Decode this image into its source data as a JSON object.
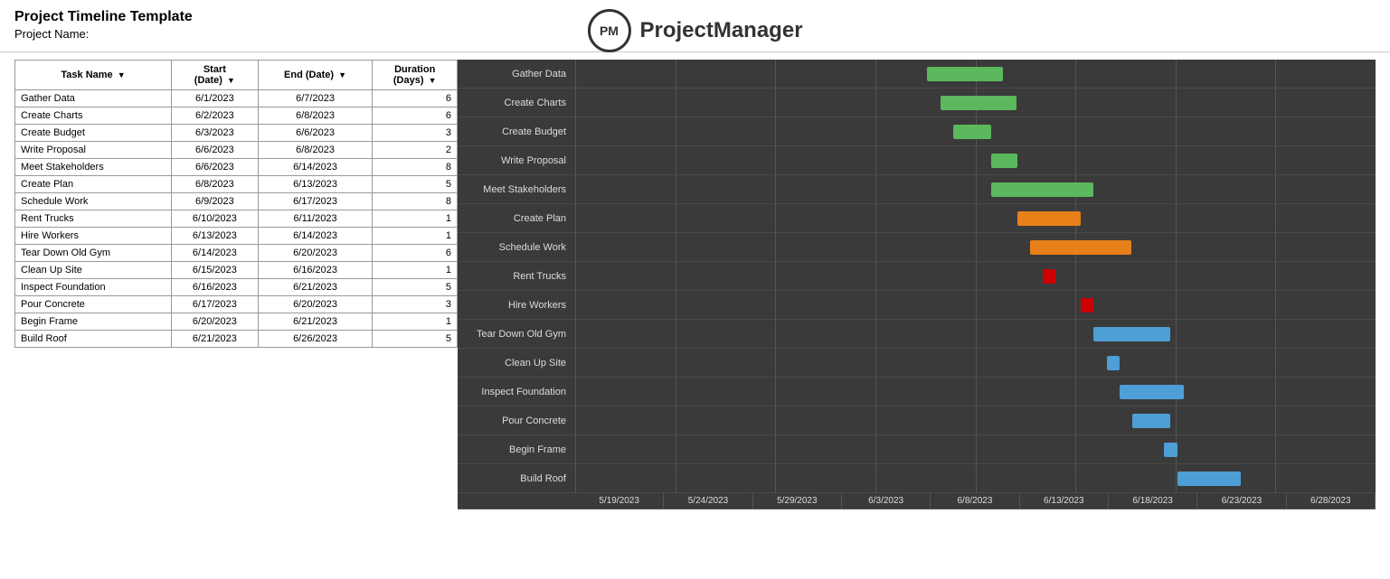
{
  "title": "Project Timeline Template",
  "projectNameLabel": "Project Name:",
  "logo": {
    "initials": "PM",
    "name": "ProjectManager"
  },
  "table": {
    "headers": [
      "Task Name",
      "Start\n(Date)",
      "End  (Date)",
      "Duration\n(Days)"
    ],
    "rows": [
      {
        "name": "Gather Data",
        "start": "6/1/2023",
        "end": "6/7/2023",
        "duration": 6
      },
      {
        "name": "Create Charts",
        "start": "6/2/2023",
        "end": "6/8/2023",
        "duration": 6
      },
      {
        "name": "Create Budget",
        "start": "6/3/2023",
        "end": "6/6/2023",
        "duration": 3
      },
      {
        "name": "Write Proposal",
        "start": "6/6/2023",
        "end": "6/8/2023",
        "duration": 2
      },
      {
        "name": "Meet Stakeholders",
        "start": "6/6/2023",
        "end": "6/14/2023",
        "duration": 8
      },
      {
        "name": "Create Plan",
        "start": "6/8/2023",
        "end": "6/13/2023",
        "duration": 5
      },
      {
        "name": "Schedule Work",
        "start": "6/9/2023",
        "end": "6/17/2023",
        "duration": 8
      },
      {
        "name": "Rent Trucks",
        "start": "6/10/2023",
        "end": "6/11/2023",
        "duration": 1
      },
      {
        "name": "Hire Workers",
        "start": "6/13/2023",
        "end": "6/14/2023",
        "duration": 1
      },
      {
        "name": "Tear Down Old Gym",
        "start": "6/14/2023",
        "end": "6/20/2023",
        "duration": 6
      },
      {
        "name": "Clean Up Site",
        "start": "6/15/2023",
        "end": "6/16/2023",
        "duration": 1
      },
      {
        "name": "Inspect Foundation",
        "start": "6/16/2023",
        "end": "6/21/2023",
        "duration": 5
      },
      {
        "name": "Pour Concrete",
        "start": "6/17/2023",
        "end": "6/20/2023",
        "duration": 3
      },
      {
        "name": "Begin Frame",
        "start": "6/20/2023",
        "end": "6/21/2023",
        "duration": 1
      },
      {
        "name": "Build Roof",
        "start": "6/21/2023",
        "end": "6/26/2023",
        "duration": 5
      }
    ]
  },
  "gantt": {
    "dateLabels": [
      "5/19/2023",
      "5/24/2023",
      "5/29/2023",
      "6/3/2023",
      "6/8/2023",
      "6/13/2023",
      "6/18/2023",
      "6/23/2023",
      "6/28/2023"
    ],
    "rowLabels": [
      "Gather Data",
      "Create Charts",
      "Create Budget",
      "Write Proposal",
      "Meet Stakeholders",
      "Create Plan",
      "Schedule Work",
      "Rent Trucks",
      "Hire Workers",
      "Tear Down Old Gym",
      "Clean Up Site",
      "Inspect Foundation",
      "Pour Concrete",
      "Begin Frame",
      "Build Roof"
    ],
    "bars": [
      {
        "color": "#5cb85c",
        "startPct": 44.0,
        "widthPct": 9.5
      },
      {
        "color": "#5cb85c",
        "startPct": 45.6,
        "widthPct": 9.5
      },
      {
        "color": "#5cb85c",
        "startPct": 47.2,
        "widthPct": 4.8
      },
      {
        "color": "#5cb85c",
        "startPct": 52.0,
        "widthPct": 3.2
      },
      {
        "color": "#5cb85c",
        "startPct": 52.0,
        "widthPct": 12.7
      },
      {
        "color": "#e8801a",
        "startPct": 55.2,
        "widthPct": 8.0
      },
      {
        "color": "#e8801a",
        "startPct": 56.8,
        "widthPct": 12.7
      },
      {
        "color": "#cc0000",
        "startPct": 58.4,
        "widthPct": 1.6
      },
      {
        "color": "#cc0000",
        "startPct": 63.2,
        "widthPct": 1.6
      },
      {
        "color": "#4d9fd6",
        "startPct": 64.8,
        "widthPct": 9.5
      },
      {
        "color": "#4d9fd6",
        "startPct": 66.4,
        "widthPct": 1.6
      },
      {
        "color": "#4d9fd6",
        "startPct": 68.0,
        "widthPct": 8.0
      },
      {
        "color": "#4d9fd6",
        "startPct": 69.6,
        "widthPct": 4.8
      },
      {
        "color": "#4d9fd6",
        "startPct": 73.6,
        "widthPct": 1.6
      },
      {
        "color": "#4d9fd6",
        "startPct": 75.2,
        "widthPct": 8.0
      }
    ]
  }
}
